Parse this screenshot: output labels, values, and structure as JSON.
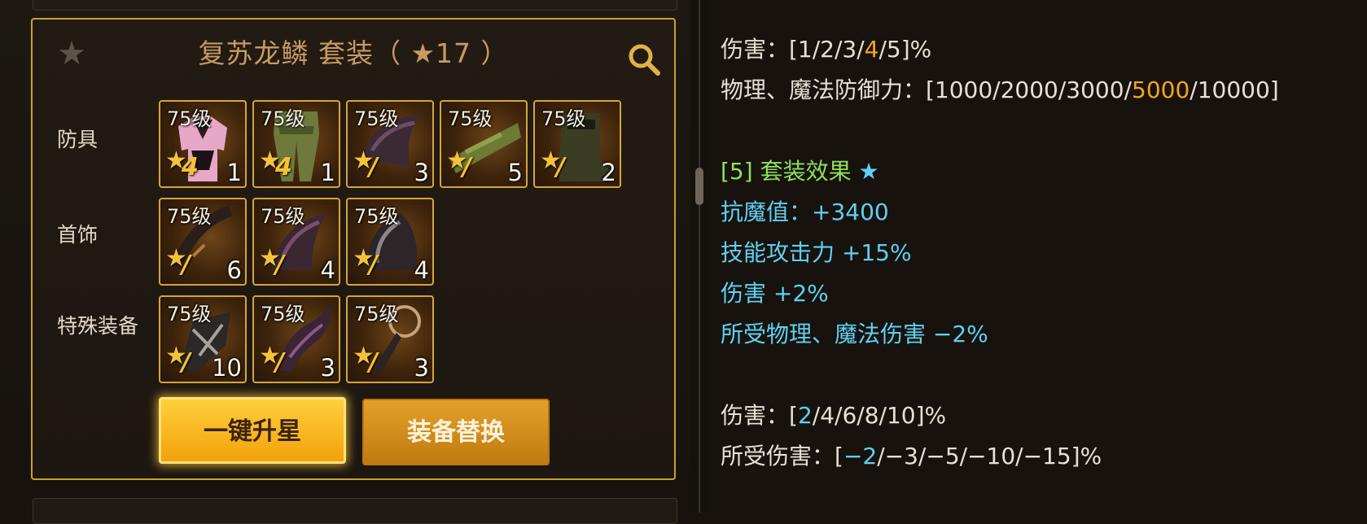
{
  "set": {
    "title": "复苏龙鳞  套装（ ★17 ）",
    "labels": {
      "armor": "防具",
      "accessory": "首饰",
      "special": "特殊装备"
    },
    "armor": [
      {
        "level": "75级",
        "tier": "4",
        "count": "1"
      },
      {
        "level": "75级",
        "tier": "4",
        "count": "1"
      },
      {
        "level": "75级",
        "tier": "/",
        "count": "3"
      },
      {
        "level": "75级",
        "tier": "/",
        "count": "5"
      },
      {
        "level": "75级",
        "tier": "/",
        "count": "2"
      }
    ],
    "accessory": [
      {
        "level": "75级",
        "tier": "/",
        "count": "6"
      },
      {
        "level": "75级",
        "tier": "/",
        "count": "4"
      },
      {
        "level": "75级",
        "tier": "/",
        "count": "4"
      }
    ],
    "special": [
      {
        "level": "75级",
        "tier": "/",
        "count": "10"
      },
      {
        "level": "75级",
        "tier": "/",
        "count": "3"
      },
      {
        "level": "75级",
        "tier": "/",
        "count": "3"
      }
    ],
    "buttons": {
      "upgrade": "一键升星",
      "replace": "装备替换"
    }
  },
  "details": {
    "line1": {
      "label": "伤害：[1/2/3/",
      "hl": "4",
      "rest": "/5]%"
    },
    "line2": {
      "label": "物理、魔法防御力：[1000/2000/3000/",
      "hl": "5000",
      "rest": "/10000]"
    },
    "effect_header": {
      "tag": "[5] 套装效果",
      "star": "★"
    },
    "effects": [
      "抗魔值：+3400",
      "技能攻击力 +15%",
      "伤害 +2%",
      "所受物理、魔法伤害 −2%"
    ],
    "line3": {
      "label": "伤害：[",
      "hl": "2",
      "rest": "/4/6/8/10]%"
    },
    "line4": {
      "label": "所受伤害：[",
      "hl": "−2",
      "rest": "/−3/−5/−10/−15]%"
    }
  },
  "colors": {
    "gold_border": "#c9a227",
    "highlight_orange": "#f2a51d",
    "effect_green": "#8ee05b",
    "effect_cyan": "#5fd0f2"
  },
  "icons": {
    "favorite": "star-icon",
    "search": "magnifier-icon"
  }
}
